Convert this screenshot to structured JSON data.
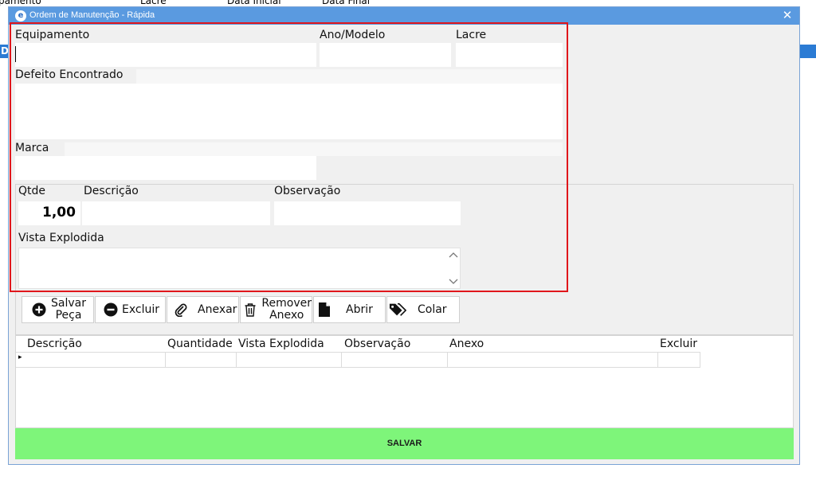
{
  "background": {
    "header_cols": [
      "pamento",
      "Lacre",
      "Data Inicial",
      "Data Final"
    ],
    "left_tab": "D"
  },
  "window": {
    "title": "Ordem de Manutenção - Rápida",
    "close_glyph": "✕"
  },
  "form": {
    "equipamento_label": "Equipamento",
    "ano_modelo_label": "Ano/Modelo",
    "lacre_label": "Lacre",
    "defeito_label": "Defeito Encontrado",
    "marca_label": "Marca",
    "equipamento_value": "",
    "ano_modelo_value": "",
    "lacre_value": "",
    "defeito_value": "",
    "marca_value": ""
  },
  "peca": {
    "qtde_label": "Qtde",
    "qtde_value": "1,00",
    "descricao_label": "Descrição",
    "observacao_label": "Observação",
    "vista_label": "Vista Explodida",
    "descricao_value": "",
    "observacao_value": "",
    "vista_value": ""
  },
  "toolbar": {
    "salvar_peca_line1": "Salvar",
    "salvar_peca_line2": "Peça",
    "excluir": "Excluir",
    "anexar": "Anexar",
    "remover_anexo_line1": "Remover",
    "remover_anexo_line2": "Anexo",
    "abrir": "Abrir",
    "colar": "Colar"
  },
  "grid": {
    "columns": [
      "Descrição",
      "Quantidade",
      "Vista Explodida",
      "Observação",
      "Anexo",
      "Excluir"
    ],
    "row_indicator": "▸"
  },
  "footer": {
    "save_label": "SALVAR",
    "save_color": "#7ef57a"
  },
  "annotation": {
    "highlight_color": "#e0161b"
  }
}
